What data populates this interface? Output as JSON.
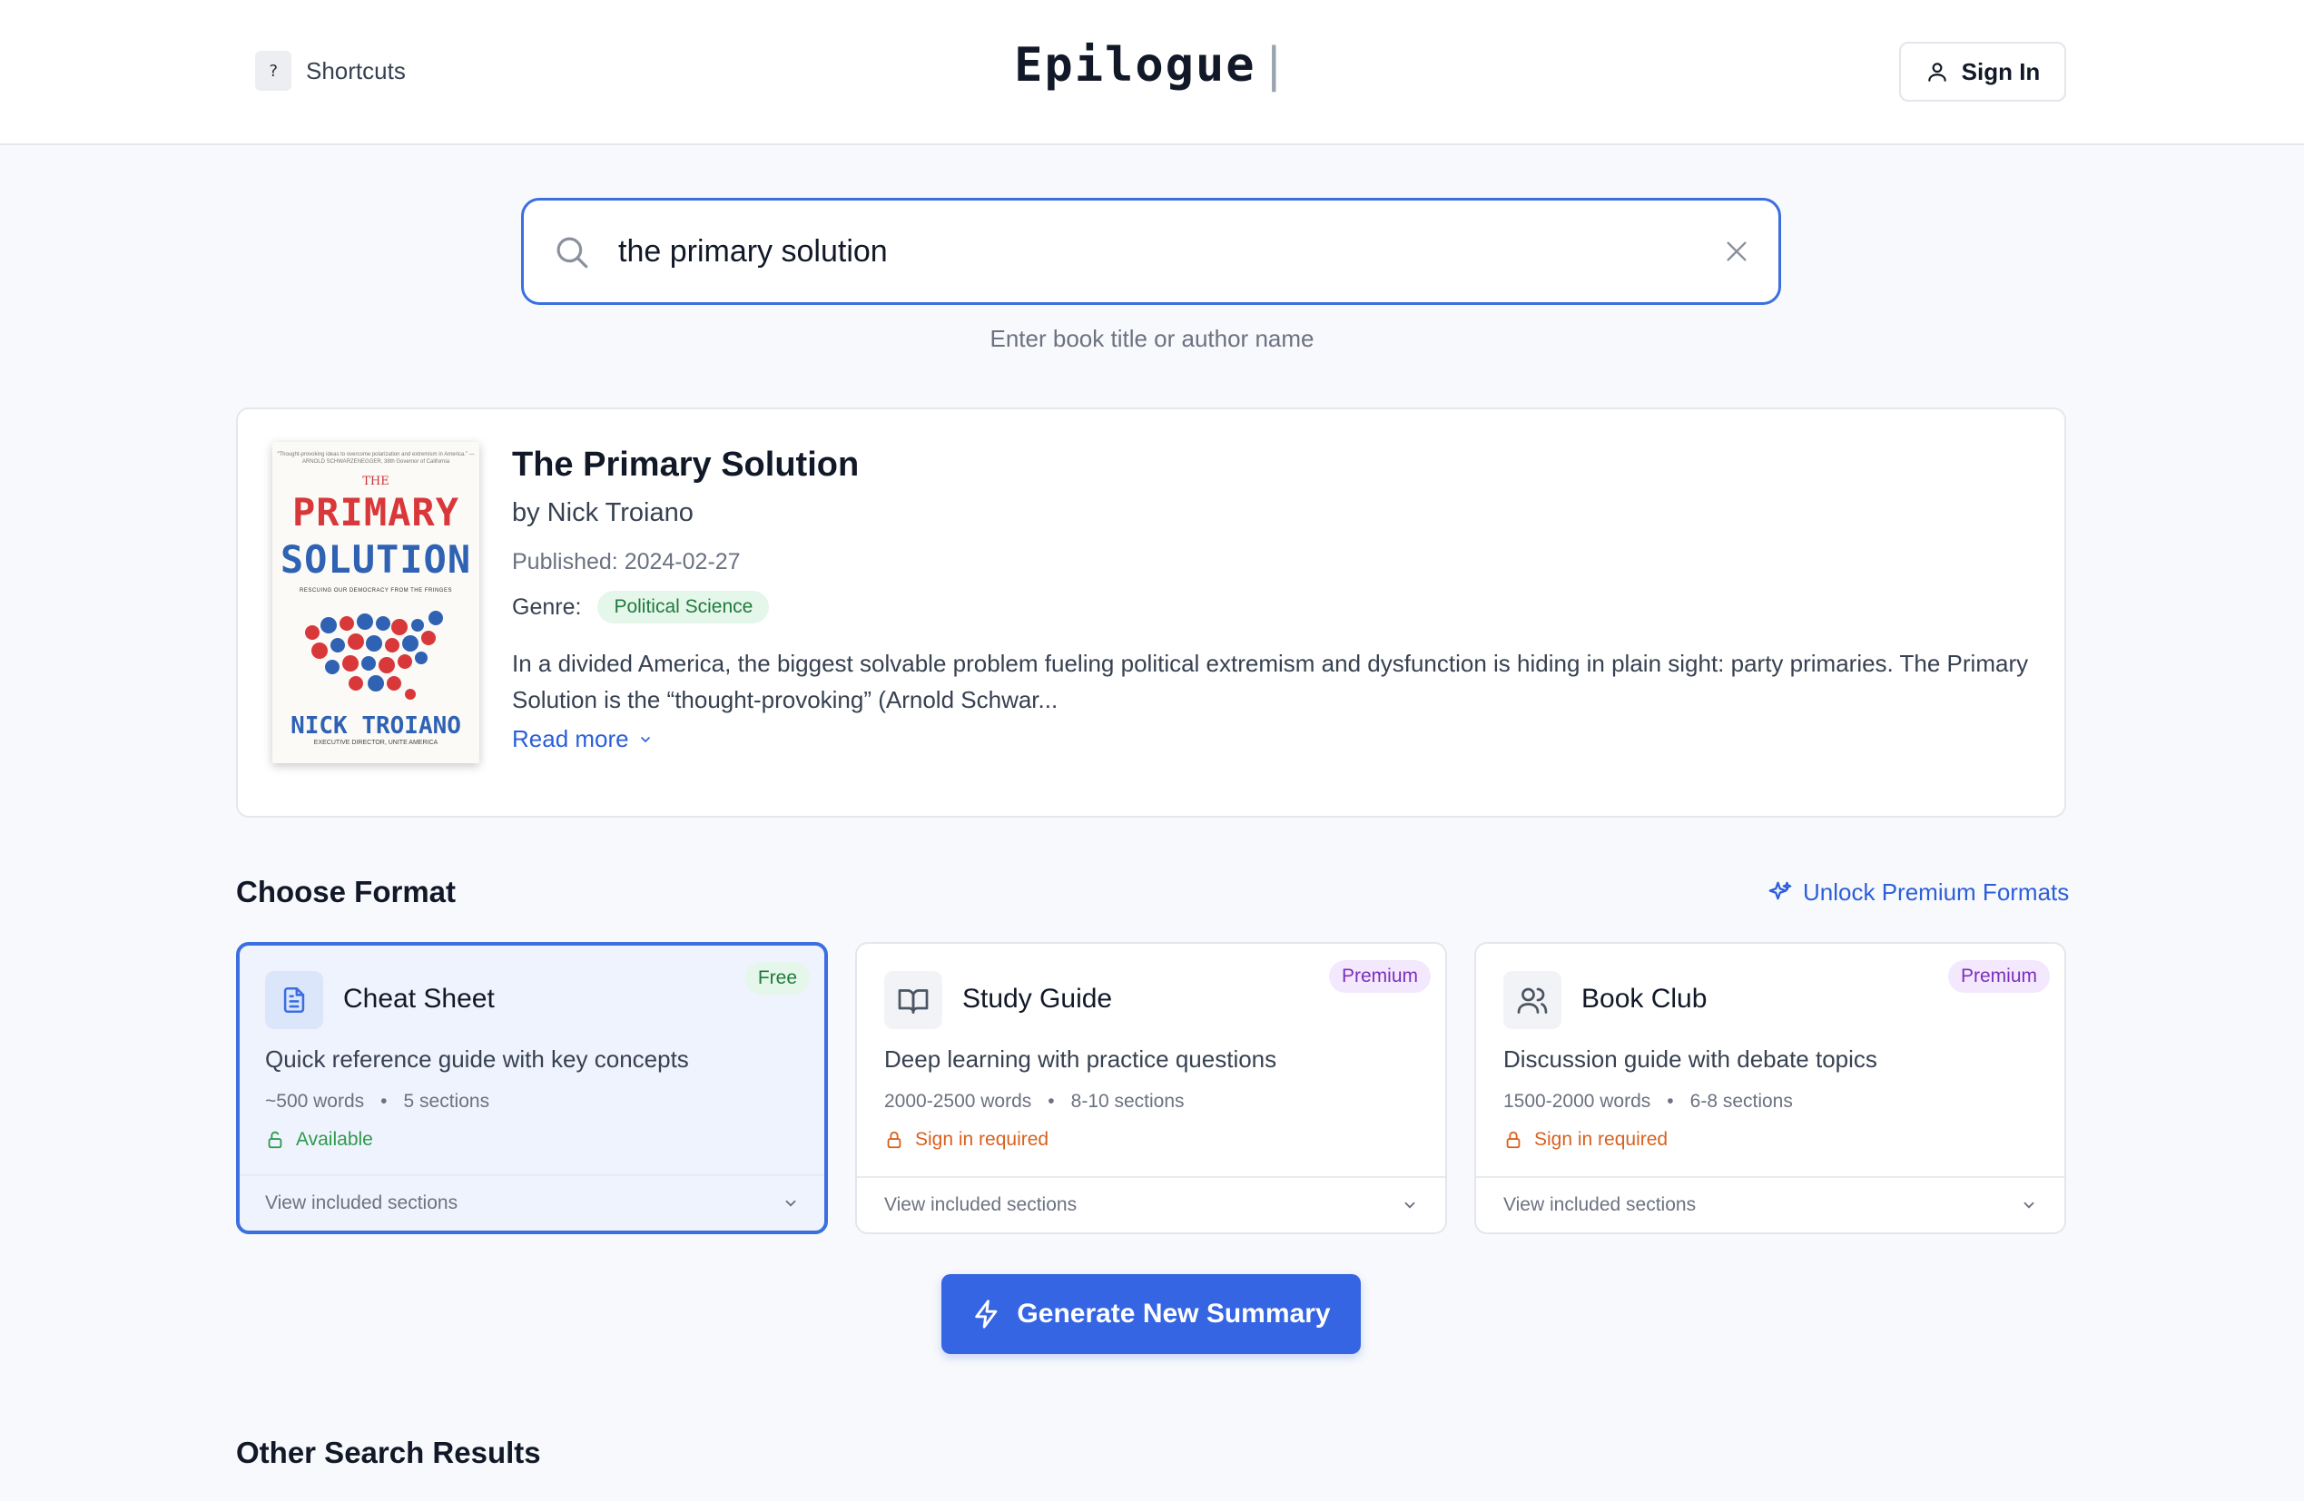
{
  "header": {
    "shortcuts_key": "?",
    "shortcuts_label": "Shortcuts",
    "logo": "Epilogue",
    "logo_cursor": "|",
    "signin_label": "Sign In"
  },
  "search": {
    "value": "the primary solution",
    "hint": "Enter book title or author name"
  },
  "book": {
    "title": "The Primary Solution",
    "author": "by Nick Troiano",
    "published": "Published: 2024-02-27",
    "genre_label": "Genre:",
    "genre": "Political Science",
    "description": "In a divided America, the biggest solvable problem fueling political extremism and dysfunction is hiding in plain sight: party primaries. The Primary Solution is the “thought-provoking” (Arnold Schwar...",
    "read_more": "Read more",
    "cover": {
      "blurb": "“Thought-provoking ideas to overcome polarization and extremism in America.” — ARNOLD SCHWARZENEGGER, 38th Governor of California",
      "the": "THE",
      "title_line1": "PRIMARY",
      "title_line2": "SOLUTION",
      "subtitle": "RESCUING OUR DEMOCRACY FROM THE FRINGES",
      "author": "NICK TROIANO",
      "role": "EXECUTIVE DIRECTOR, UNITE AMERICA"
    }
  },
  "formats_section": {
    "title": "Choose Format",
    "unlock_label": "Unlock Premium Formats",
    "cards": [
      {
        "name": "Cheat Sheet",
        "badge": "Free",
        "description": "Quick reference guide with key concepts",
        "words": "~500 words",
        "sections": "5 sections",
        "status": "Available",
        "footer": "View included sections"
      },
      {
        "name": "Study Guide",
        "badge": "Premium",
        "description": "Deep learning with practice questions",
        "words": "2000-2500 words",
        "sections": "8-10 sections",
        "status": "Sign in required",
        "footer": "View included sections"
      },
      {
        "name": "Book Club",
        "badge": "Premium",
        "description": "Discussion guide with debate topics",
        "words": "1500-2000 words",
        "sections": "6-8 sections",
        "status": "Sign in required",
        "footer": "View included sections"
      }
    ],
    "separator": "•"
  },
  "generate_label": "Generate New Summary",
  "other_results_title": "Other Search Results",
  "colors": {
    "accent": "#3565e3",
    "free": "#1f7a3d",
    "premium": "#7b2fbe",
    "locked": "#d9601f"
  }
}
